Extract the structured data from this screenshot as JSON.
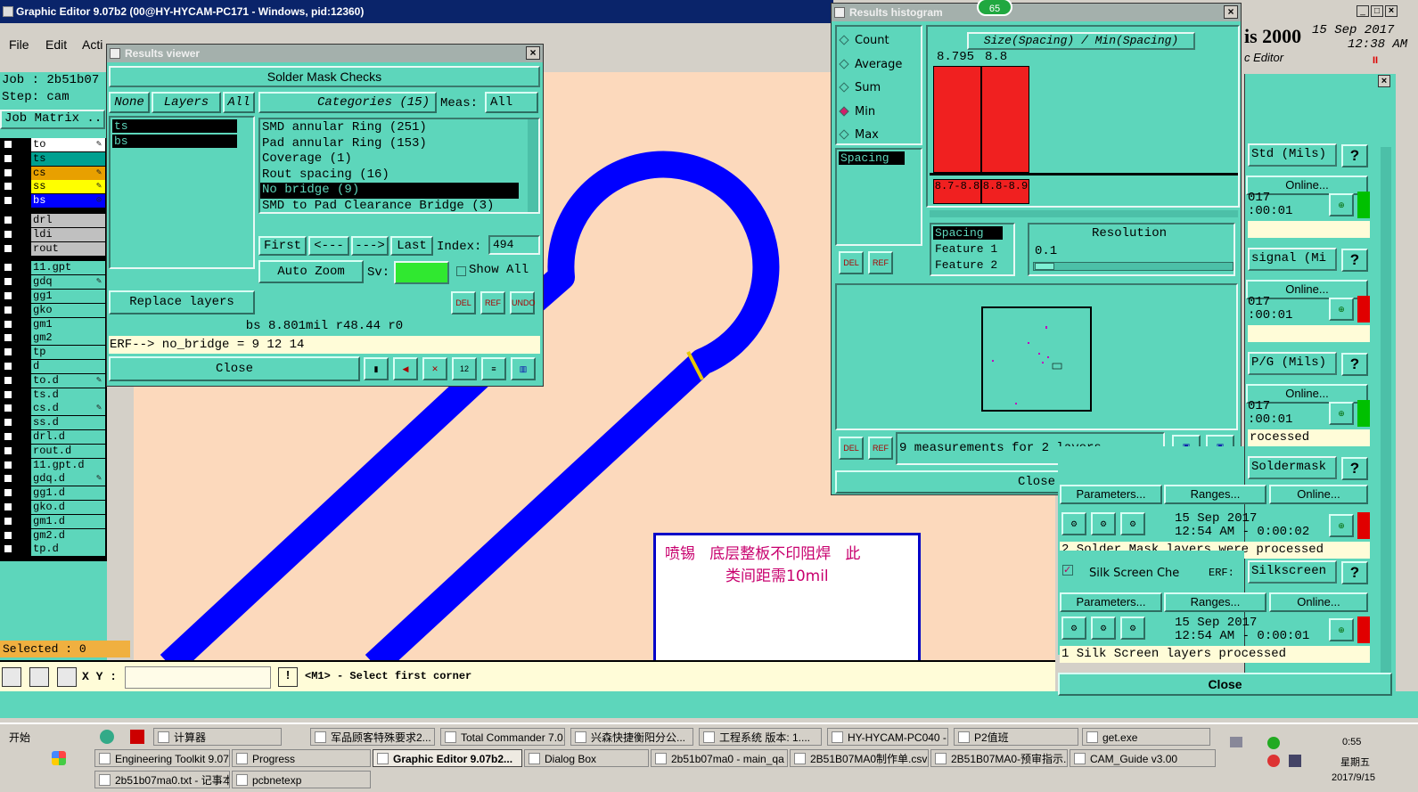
{
  "main_window": {
    "title": "Graphic Editor 9.07b2 (00@HY-HYCAM-PC171 - Windows, pid:12360)",
    "menu": [
      "File",
      "Edit",
      "Acti"
    ]
  },
  "job_panel": {
    "job_label": "Job : 2b51b07",
    "step_label": "Step: cam",
    "matrix_label": "Job Matrix ..",
    "selected": "Selected : 0"
  },
  "layers": [
    {
      "name": "to",
      "color": "#ffffff",
      "mark": "✎"
    },
    {
      "name": "ts",
      "color": "#00a090",
      "mark": ""
    },
    {
      "name": "cs",
      "color": "#e8a000",
      "mark": "✎"
    },
    {
      "name": "ss",
      "color": "#ffff00",
      "mark": "✎"
    },
    {
      "name": "bs",
      "color": "#0000ff",
      "mark": "⊙"
    },
    {
      "name": "drl",
      "color": "#c0c0c0",
      "mark": ""
    },
    {
      "name": "ldi",
      "color": "#c0c0c0",
      "mark": ""
    },
    {
      "name": "rout",
      "color": "#c0c0c0",
      "mark": ""
    },
    {
      "name": "11.gpt",
      "color": "#5dd6bb",
      "mark": ""
    },
    {
      "name": "gdq",
      "color": "#5dd6bb",
      "mark": "✎"
    },
    {
      "name": "gg1",
      "color": "#5dd6bb",
      "mark": ""
    },
    {
      "name": "gko",
      "color": "#5dd6bb",
      "mark": ""
    },
    {
      "name": "gm1",
      "color": "#5dd6bb",
      "mark": ""
    },
    {
      "name": "gm2",
      "color": "#5dd6bb",
      "mark": ""
    },
    {
      "name": "tp",
      "color": "#5dd6bb",
      "mark": ""
    },
    {
      "name": "d",
      "color": "#5dd6bb",
      "mark": ""
    },
    {
      "name": "to.d",
      "color": "#5dd6bb",
      "mark": "✎"
    },
    {
      "name": "ts.d",
      "color": "#5dd6bb",
      "mark": ""
    },
    {
      "name": "cs.d",
      "color": "#5dd6bb",
      "mark": "✎"
    },
    {
      "name": "ss.d",
      "color": "#5dd6bb",
      "mark": ""
    },
    {
      "name": "drl.d",
      "color": "#5dd6bb",
      "mark": ""
    },
    {
      "name": "rout.d",
      "color": "#5dd6bb",
      "mark": ""
    },
    {
      "name": "11.gpt.d",
      "color": "#5dd6bb",
      "mark": ""
    },
    {
      "name": "gdq.d",
      "color": "#5dd6bb",
      "mark": "✎"
    },
    {
      "name": "gg1.d",
      "color": "#5dd6bb",
      "mark": ""
    },
    {
      "name": "gko.d",
      "color": "#5dd6bb",
      "mark": ""
    },
    {
      "name": "gm1.d",
      "color": "#5dd6bb",
      "mark": ""
    },
    {
      "name": "gm2.d",
      "color": "#5dd6bb",
      "mark": ""
    },
    {
      "name": "tp.d",
      "color": "#5dd6bb",
      "mark": ""
    }
  ],
  "bottom_bar": {
    "xy_label": "X Y :",
    "xy_value": "",
    "prompt": "<M1> - Select first corner"
  },
  "annotation": {
    "line1": "喷锡   底层整板不印阻焊   此",
    "line2": "类间距需10mil"
  },
  "results_viewer": {
    "title": "Results viewer",
    "header": "Solder Mask Checks",
    "none_btn": "None",
    "layers_btn": "Layers",
    "all_btn": "All",
    "categories_label": "Categories (15)",
    "meas_label": "Meas:",
    "meas_value": "All",
    "layers": [
      "ts",
      "bs"
    ],
    "categories": [
      "SMD annular Ring (251)",
      "Pad annular Ring (153)",
      "Coverage (1)",
      "Rout spacing (16)",
      "No bridge (9)",
      "SMD to Pad Clearance Bridge (3)"
    ],
    "selected_category": 4,
    "first_btn": "First",
    "prev_btn": "<---",
    "next_btn": "--->",
    "last_btn": "Last",
    "index_label": "Index:",
    "index_value": "494",
    "autozoom": "Auto Zoom",
    "sv_label": "Sv:",
    "show_all": "Show All",
    "replace_layers": "Replace layers",
    "del": "DEL",
    "ref": "REF",
    "undo": "UNDO",
    "status": "bs 8.801mil   r48.44  r0",
    "erf_line": "ERF--> no_bridge = 9 12 14",
    "close": "Close"
  },
  "histogram": {
    "title": "Results histogram",
    "badge": "65",
    "options": [
      "Count",
      "Average",
      "Sum",
      "Min",
      "Max"
    ],
    "selected_option": "Min",
    "expr": "Size(Spacing) / Min(Spacing)",
    "bars": [
      {
        "top": "8.795",
        "range": "8.7-8.8",
        "value": 1.0
      },
      {
        "top": "8.8",
        "range": "8.8-8.9",
        "value": 1.0
      }
    ],
    "list_item": "Spacing",
    "del": "DEL",
    "ref": "REF",
    "feature_rows": [
      "Spacing",
      "Feature 1",
      "Feature 2"
    ],
    "resolution_label": "Resolution",
    "resolution_value": "0.1",
    "summary": "9 measurements for 2 layers",
    "close": "Close"
  },
  "right_panel": {
    "header_text": "is 2000",
    "date_line1": "15 Sep 2017",
    "date_line2": "12:38 AM",
    "editor": "c Editor",
    "rows": [
      {
        "name": "Std (Mils)",
        "online": "Online...",
        "time": "017\n:00:01",
        "status_color": "#00c000",
        "msg": ""
      },
      {
        "name": "signal (Mi",
        "online": "Online...",
        "time": "017\n:00:01",
        "status_color": "#e00000",
        "msg": ""
      },
      {
        "name": "P/G (Mils)",
        "online": "Online...",
        "time": "017\n:00:01",
        "status_color": "#00c000",
        "msg": "rocessed"
      },
      {
        "name": "Soldermask",
        "online": "Online...",
        "params": "Parameters...",
        "ranges": "Ranges...",
        "time": "15 Sep 2017\n12:54 AM - 0:00:02",
        "status_color": "#e00000",
        "msg": "2 Solder Mask layers were processed"
      },
      {
        "name": "Silkscreen",
        "label": "Silk Screen Che",
        "erf": "ERF:",
        "online": "Online...",
        "params": "Parameters...",
        "ranges": "Ranges...",
        "time": "15 Sep 2017\n12:54 AM - 0:00:01",
        "status_color": "#e00000",
        "msg": "1 Silk Screen layers processed"
      }
    ],
    "close": "Close"
  },
  "taskbar": {
    "start": "开始",
    "row1": [
      "计算器",
      "军品顾客特殊要求2...",
      "Total Commander 7.0...",
      "兴森快捷衡阳分公...",
      "工程系统  版本: 1....",
      "HY-HYCAM-PC040 - T...",
      "P2值班",
      "get.exe"
    ],
    "row2": [
      "Engineering Toolkit 9.07...",
      "Progress",
      "Graphic Editor 9.07b2...",
      "Dialog Box",
      "2b51b07ma0 - main_qa",
      "2B51B07MA0制作单.csv",
      "2B51B07MA0-预审指示...",
      "CAM_Guide v3.00"
    ],
    "row3": [
      "2b51b07ma0.txt - 记事本",
      "pcbnetexp"
    ],
    "clock": "0:55",
    "weekday": "星期五",
    "date": "2017/9/15"
  }
}
